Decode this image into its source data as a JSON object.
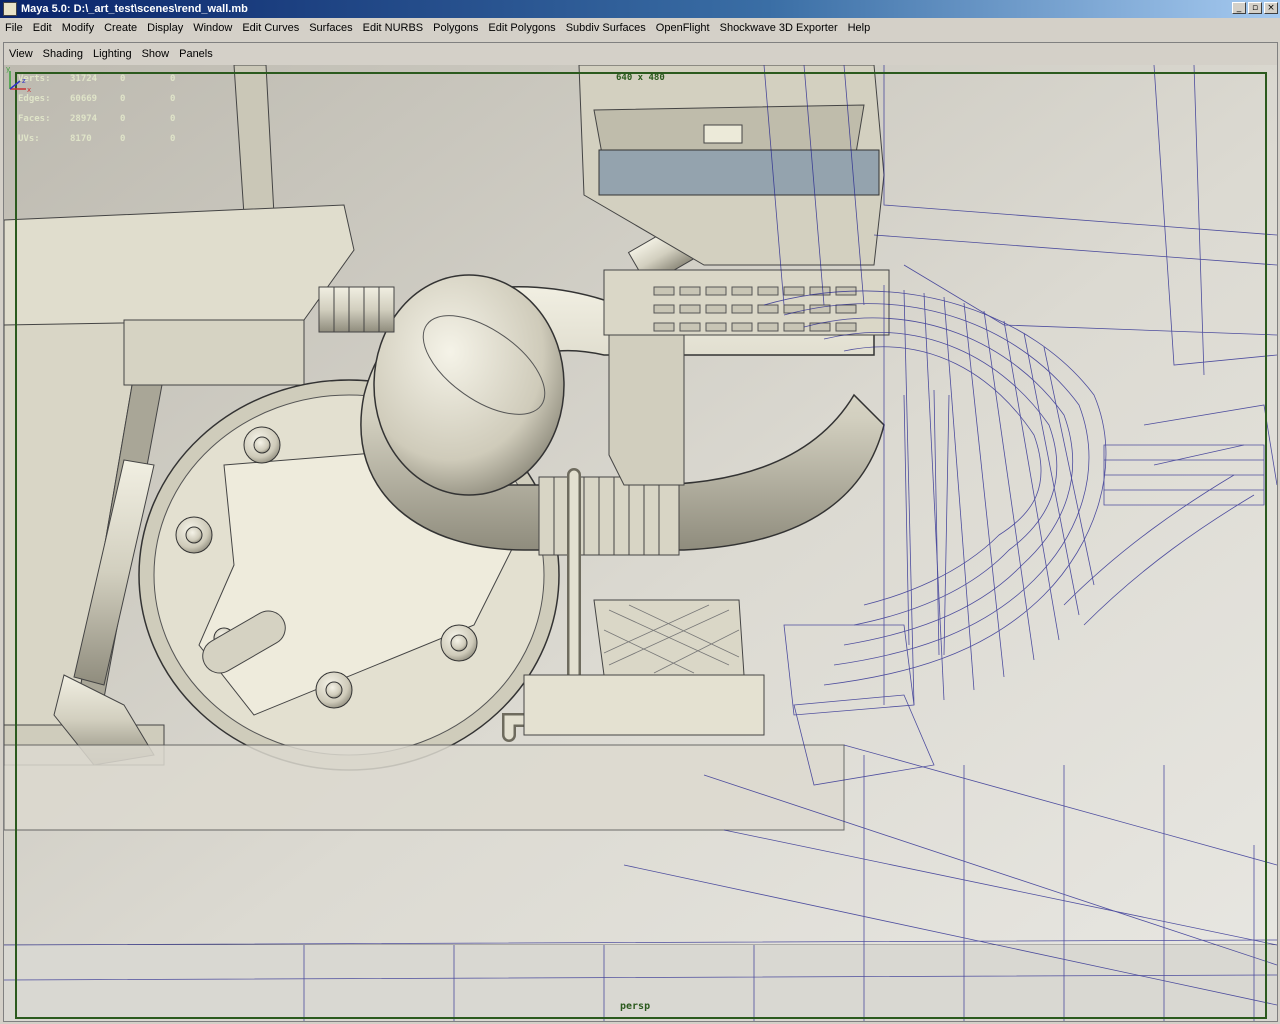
{
  "window": {
    "title": "Maya 5.0: D:\\_art_test\\scenes\\rend_wall.mb",
    "controls": [
      "_",
      "▫",
      "×"
    ]
  },
  "menubar": {
    "items": [
      "File",
      "Edit",
      "Modify",
      "Create",
      "Display",
      "Window",
      "Edit Curves",
      "Surfaces",
      "Edit NURBS",
      "Polygons",
      "Edit Polygons",
      "Subdiv Surfaces",
      "OpenFlight",
      "Shockwave 3D Exporter",
      "Help"
    ]
  },
  "panel_menu": {
    "items": [
      "View",
      "Shading",
      "Lighting",
      "Show",
      "Panels"
    ]
  },
  "hud": {
    "rows": [
      {
        "label": "Verts:",
        "value": "31724",
        "v1": "0",
        "v2": "0"
      },
      {
        "label": "Edges:",
        "value": "60669",
        "v1": "0",
        "v2": "0"
      },
      {
        "label": "Faces:",
        "value": "28974",
        "v1": "0",
        "v2": "0"
      },
      {
        "label": "UVs:",
        "value": "8170",
        "v1": "0",
        "v2": "0"
      }
    ]
  },
  "viewport": {
    "resolution_gate_label": "640 x 480",
    "camera_name": "persp",
    "axis_labels": {
      "x": "x",
      "y": "y",
      "z": "z"
    },
    "colors": {
      "background": "#c9c6ba",
      "shaded_surface": "#e6e3d3",
      "surface_shadow": "#9b9888",
      "wireframe": "#1e1e8c",
      "gate": "#2b5a1e"
    }
  }
}
